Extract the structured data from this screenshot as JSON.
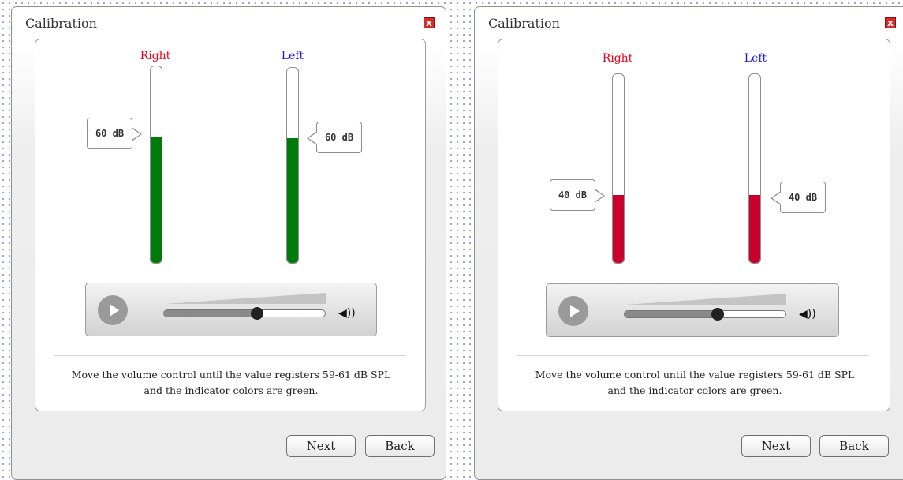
{
  "dialogs": [
    {
      "title": "Calibration",
      "close_label": "x",
      "right_channel": {
        "label": "Right",
        "value_label": "60 dB",
        "level": 0.64,
        "color": "#007a0a"
      },
      "left_channel": {
        "label": "Left",
        "value_label": "60 dB",
        "level": 0.64,
        "color": "#007a0a"
      },
      "player": {
        "play_icon": "play-icon",
        "volume": 0.58,
        "speaker_icon": "speaker-icon",
        "speaker_glyph": "◀))"
      },
      "instruction_line1": "Move the volume control until the value registers 59-61 dB SPL",
      "instruction_line2": "and the indicator colors are green.",
      "next_label": "Next",
      "back_label": "Back"
    },
    {
      "title": "Calibration",
      "close_label": "x",
      "right_channel": {
        "label": "Right",
        "value_label": "40 dB",
        "level": 0.36,
        "color": "#c8002c"
      },
      "left_channel": {
        "label": "Left",
        "value_label": "40 dB",
        "level": 0.36,
        "color": "#c8002c"
      },
      "player": {
        "play_icon": "play-icon",
        "volume": 0.58,
        "speaker_icon": "speaker-icon",
        "speaker_glyph": "◀))"
      },
      "instruction_line1": "Move the volume control until the value registers 59-61 dB SPL",
      "instruction_line2": "and the indicator colors are green.",
      "next_label": "Next",
      "back_label": "Back"
    }
  ],
  "colors": {
    "right_label": "#e8001c",
    "left_label": "#1a1ae0",
    "close_button": "#d62b2b"
  }
}
